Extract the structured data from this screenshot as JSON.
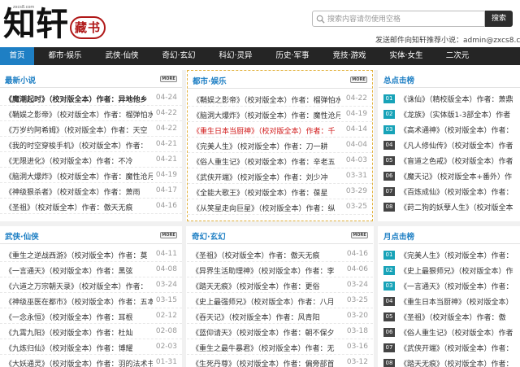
{
  "header": {
    "logo_url": "zxcs8.com",
    "logo_char_1": "知",
    "logo_char_2": "轩",
    "logo_seal": "藏书",
    "search_placeholder": "搜索内容请勿使用空格",
    "search_button": "搜索",
    "email_line": "发送邮件向知轩推荐小说：admin@zxcs8.com"
  },
  "nav": {
    "items": [
      "首页",
      "都市·娱乐",
      "武侠·仙侠",
      "奇幻·玄幻",
      "科幻·灵异",
      "历史·军事",
      "竞技·游戏",
      "实体·女生",
      "二次元"
    ],
    "active_index": 0
  },
  "more_label": "MORE",
  "panels": {
    "latest": {
      "title": "最新小说",
      "rows": [
        {
          "title": "《魔潮起时》（校对版全本）作者：异地他乡",
          "date": "04-24",
          "bold": true
        },
        {
          "title": "《鞘娱之影帝》（校对版全本）作者：榴弹怕水",
          "date": "04-22"
        },
        {
          "title": "《万岁约阿希姆》（校对版全本）作者：天空",
          "date": "04-22"
        },
        {
          "title": "《我的时空穿梭手机》（校对版全本）作者：",
          "date": "04-21"
        },
        {
          "title": "《无限进化》（校对版全本）作者：不冷",
          "date": "04-21"
        },
        {
          "title": "《脑洞大爆炸》（校对版全本）作者：魔性沧月",
          "date": "04-19"
        },
        {
          "title": "《神级狠杀者》（校对版全本）作者：萧雨",
          "date": "04-17"
        },
        {
          "title": "《圣祖》（校对版全本）作者：傲天无痕",
          "date": "04-16"
        }
      ]
    },
    "urban": {
      "title": "都市·娱乐",
      "rows": [
        {
          "title": "《鞘娱之影帝》（校对版全本）作者：榴弹怕水",
          "date": "04-22"
        },
        {
          "title": "《脑洞大爆炸》（校对版全本）作者：魔性沧月",
          "date": "04-19"
        },
        {
          "title": "《重生日本当厨神》（校对版全本）作者：千",
          "date": "04-14",
          "red": true
        },
        {
          "title": "《完美人生》（校对版全本）作者：刀一耕",
          "date": "04-04"
        },
        {
          "title": "《俗人重生记》（校对版全本）作者：辛老五",
          "date": "04-03"
        },
        {
          "title": "《武侠开端》（校对版全本）作者：刘少冲",
          "date": "03-31"
        },
        {
          "title": "《全能大歌王》（校对版全本）作者：葆星",
          "date": "03-29"
        },
        {
          "title": "《从笑星走向巨星》（校对版全本）作者：纵",
          "date": "03-25"
        }
      ]
    },
    "hot": {
      "title": "总点击榜",
      "rows": [
        {
          "no": "01",
          "title": "《诛仙》（精校版全本）作者：萧鼎"
        },
        {
          "no": "02",
          "title": "《龙族》（实体版1-3部全本）作者"
        },
        {
          "no": "03",
          "title": "《高术通神》（校对版全本）作者："
        },
        {
          "no": "04",
          "title": "《凡人修仙传》（校对版全本）作者"
        },
        {
          "no": "05",
          "title": "《盲道之色戒》（校对版全本）作者"
        },
        {
          "no": "06",
          "title": "《魔天记》（校对版全本+番外）作"
        },
        {
          "no": "07",
          "title": "《百炼成仙》（校对版全本）作者："
        },
        {
          "no": "08",
          "title": "《莳二狗的妖孽人生》（校对版全本"
        }
      ]
    },
    "wuxia": {
      "title": "武侠·仙侠",
      "rows": [
        {
          "title": "《重生之逆战西游》（校对版全本）作者：莫",
          "date": "04-11"
        },
        {
          "title": "《一言通天》（校对版全本）作者：黑弦",
          "date": "04-08"
        },
        {
          "title": "《六道之万宗朝天录》（校对版全本）作者：",
          "date": "03-24"
        },
        {
          "title": "《神级巫医在都市》（校对版全本）作者：五本",
          "date": "03-15"
        },
        {
          "title": "《一念永恒》（校对版全本）作者：耳根",
          "date": "02-12"
        },
        {
          "title": "《九霄九阳》（校对版全本）作者：杜灿",
          "date": "02-08"
        },
        {
          "title": "《九炼归仙》（校对版全本）作者：博耀",
          "date": "02-03"
        },
        {
          "title": "《大妖通灵》（校对版全本）作者：羽的法术书",
          "date": "01-31"
        }
      ]
    },
    "fantasy": {
      "title": "奇幻·玄幻",
      "rows": [
        {
          "title": "《圣祖》（校对版全本）作者：傲天无痕",
          "date": "04-16"
        },
        {
          "title": "《异界生活助理神》（校对版全本）作者：李",
          "date": "04-06"
        },
        {
          "title": "《踏天无痕》（校对版全本）作者：更俗",
          "date": "03-24"
        },
        {
          "title": "《史上最强师兄》（校对版全本）作者：八月",
          "date": "03-25"
        },
        {
          "title": "《吞天记》（校对版全本）作者：风青阳",
          "date": "03-20"
        },
        {
          "title": "《蓝仰请天》（校对版全本）作者：朝不保夕",
          "date": "03-18"
        },
        {
          "title": "《重生之最牛暴君》（校对版全本）作者：无",
          "date": "03-16"
        },
        {
          "title": "《生死丹尊》（校对版全本）作者：偏旁部首",
          "date": "03-12"
        }
      ]
    },
    "monthly": {
      "title": "月点击榜",
      "rows": [
        {
          "no": "01",
          "title": "《完美人生》（校对版全本）作者："
        },
        {
          "no": "02",
          "title": "《史上最狠师兄》（校对版全本）作"
        },
        {
          "no": "03",
          "title": "《一言通天》（校对版全本）作者："
        },
        {
          "no": "04",
          "title": "《重生日本当厨神》（校对版全本）"
        },
        {
          "no": "05",
          "title": "《圣祖》（校对版全本）作者：傲"
        },
        {
          "no": "06",
          "title": "《俗人重生记》（校对版全本）作者"
        },
        {
          "no": "07",
          "title": "《武侠开端》（校对版全本）作者："
        },
        {
          "no": "08",
          "title": "《踏天无痕》（校对版全本）作者："
        }
      ]
    }
  },
  "colors": {
    "accent": "#1e7fc4",
    "nav_bg": "#252525",
    "rank_top": "#18a3b8",
    "highlight": "#d01818"
  }
}
